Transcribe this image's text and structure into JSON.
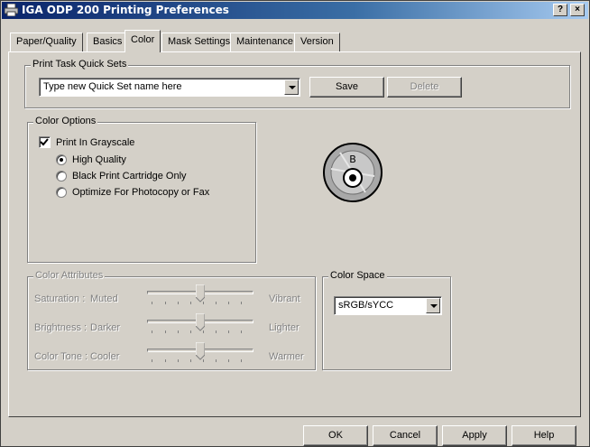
{
  "window": {
    "title": "IGA ODP 200 Printing Preferences",
    "help_btn": "?",
    "close_btn": "×"
  },
  "tabs": [
    {
      "label": "Paper/Quality",
      "active": false
    },
    {
      "label": "Basics",
      "active": false
    },
    {
      "label": "Color",
      "active": true
    },
    {
      "label": "Mask Settings",
      "active": false
    },
    {
      "label": "Maintenance",
      "active": false
    },
    {
      "label": "Version",
      "active": false
    }
  ],
  "quick_sets": {
    "group_label": "Print Task Quick Sets",
    "combo_value": "Type new Quick Set name here",
    "save_label": "Save",
    "delete_label": "Delete"
  },
  "color_options": {
    "group_label": "Color Options",
    "grayscale_label": "Print In Grayscale",
    "grayscale_checked": true,
    "radios": [
      {
        "label": "High Quality",
        "selected": true
      },
      {
        "label": "Black Print Cartridge Only",
        "selected": false
      },
      {
        "label": "Optimize For Photocopy or Fax",
        "selected": false
      }
    ],
    "preview_letter": "B"
  },
  "color_attributes": {
    "group_label": "Color Attributes",
    "sliders": [
      {
        "label": "Saturation :",
        "low": "Muted",
        "high": "Vibrant",
        "value": 0.5
      },
      {
        "label": "Brightness :",
        "low": "Darker",
        "high": "Lighter",
        "value": 0.5
      },
      {
        "label": "Color Tone :",
        "low": "Cooler",
        "high": "Warmer",
        "value": 0.5
      }
    ]
  },
  "color_space": {
    "group_label": "Color Space",
    "value": "sRGB/sYCC"
  },
  "footer": {
    "ok": "OK",
    "cancel": "Cancel",
    "apply": "Apply",
    "help": "Help"
  }
}
